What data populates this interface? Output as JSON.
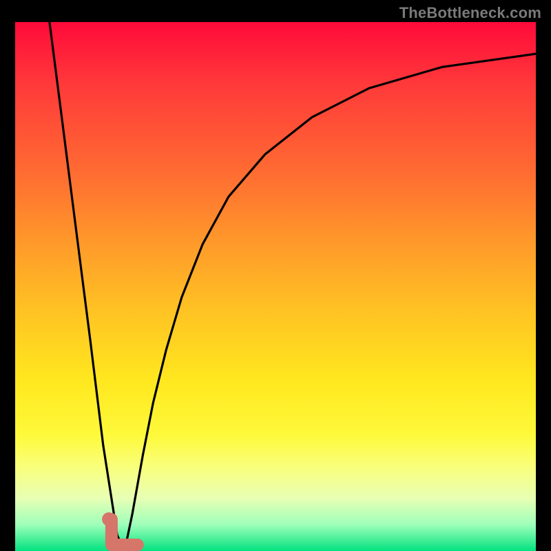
{
  "watermark": {
    "text": "TheBottleneck.com"
  },
  "chart_data": {
    "type": "line",
    "title": "",
    "xlabel": "",
    "ylabel": "",
    "xlim": [
      0,
      100
    ],
    "ylim": [
      0,
      100
    ],
    "grid": false,
    "legend": false,
    "background": "heatmap-gradient-red-to-green-vertical",
    "series": [
      {
        "name": "left-branch",
        "x": [
          6.6,
          9.2,
          11.8,
          14.4,
          16.9,
          19.6,
          21.0
        ],
        "values": [
          100,
          80,
          60,
          40,
          20,
          3,
          0
        ]
      },
      {
        "name": "right-branch",
        "x": [
          21.0,
          22.5,
          24.5,
          26.5,
          29.0,
          32.0,
          36.0,
          41.0,
          48.0,
          57.0,
          68.0,
          82.0,
          100.0
        ],
        "values": [
          0,
          7,
          18,
          28,
          38,
          48,
          58,
          67,
          75,
          82,
          87.5,
          91.5,
          94
        ]
      }
    ],
    "marker": {
      "name": "highlight-dot",
      "x": 18.0,
      "y": 6,
      "color": "#d67569"
    },
    "notch": {
      "name": "bottom-notch",
      "x_range": [
        18.5,
        23.5
      ],
      "height": 6,
      "color": "#d67569"
    }
  }
}
